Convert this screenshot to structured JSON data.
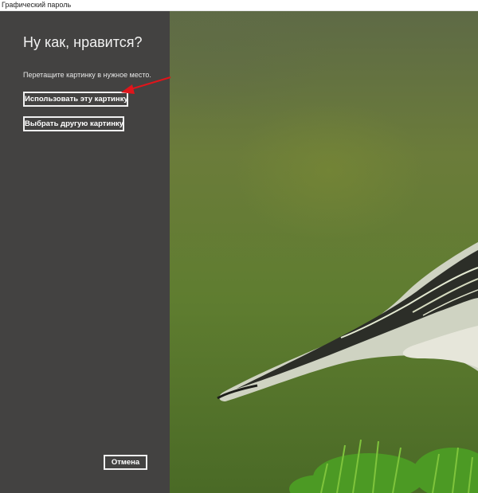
{
  "window": {
    "title": "Графический пароль"
  },
  "panel": {
    "heading": "Ну как, нравится?",
    "instruction": "Перетащите картинку в нужное место.",
    "use_picture_label": "Использовать эту картинку",
    "choose_other_label": "Выбрать другую картинку",
    "cancel_label": "Отмена"
  },
  "colors": {
    "panel_background": "#434241",
    "annotation_arrow": "#e0151b",
    "button_border": "#f0f0f0"
  },
  "icons": {
    "annotation": "red-arrow-icon"
  }
}
